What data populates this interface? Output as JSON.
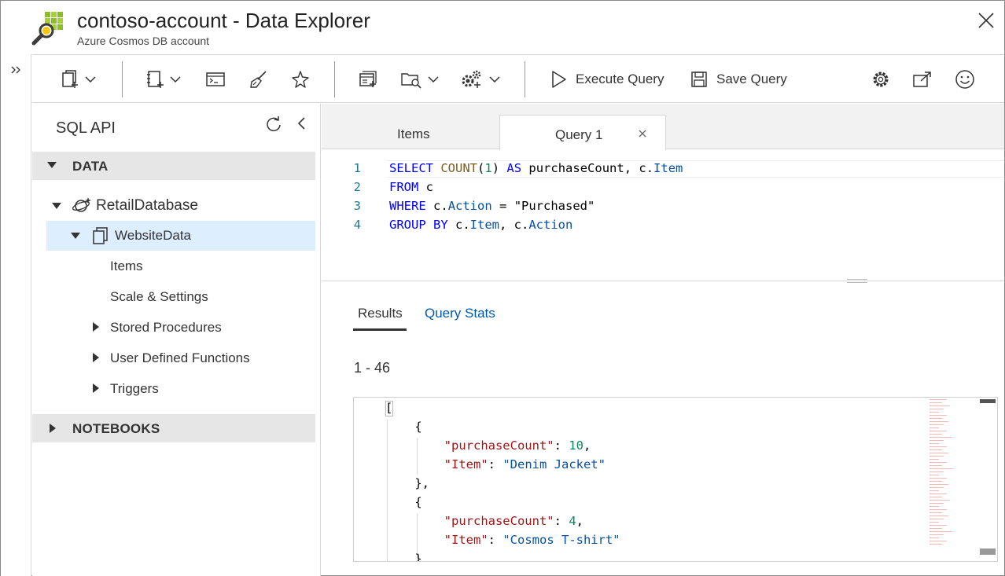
{
  "window": {
    "title": "contoso-account - Data Explorer",
    "subtitle": "Azure Cosmos DB account"
  },
  "toolbar": {
    "execute_label": "Execute Query",
    "save_label": "Save Query"
  },
  "tree": {
    "header": "SQL API",
    "data_section": "DATA",
    "database": "RetailDatabase",
    "container": "WebsiteData",
    "children": [
      "Items",
      "Scale & Settings",
      "Stored Procedures",
      "User Defined Functions",
      "Triggers"
    ],
    "notebooks_section": "NOTEBOOKS"
  },
  "tabs": [
    {
      "label": "Items"
    },
    {
      "label": "Query 1"
    }
  ],
  "editor": {
    "line_numbers": [
      "1",
      "2",
      "3",
      "4"
    ],
    "tokens": {
      "select": "SELECT",
      "count": "COUNT",
      "one": "1",
      "as": "AS",
      "alias": "purchaseCount, c.",
      "item": "Item",
      "from": "FROM",
      "from_src": "c",
      "where": "WHERE",
      "where_c": "c.",
      "action": "Action",
      "equals": " = ",
      "purchased": "\"Purchased\"",
      "group": "GROUP BY",
      "group_c": "c.",
      "group_mid": ", c."
    }
  },
  "results": {
    "tab_results": "Results",
    "tab_stats": "Query Stats",
    "range": "1 - 46",
    "rows": [
      {
        "purchaseCount_key": "\"purchaseCount\"",
        "purchaseCount": "10",
        "item_key": "\"Item\"",
        "item": "\"Denim Jacket\""
      },
      {
        "purchaseCount_key": "\"purchaseCount\"",
        "purchaseCount": "4",
        "item_key": "\"Item\"",
        "item": "\"Cosmos T-shirt\""
      }
    ]
  }
}
